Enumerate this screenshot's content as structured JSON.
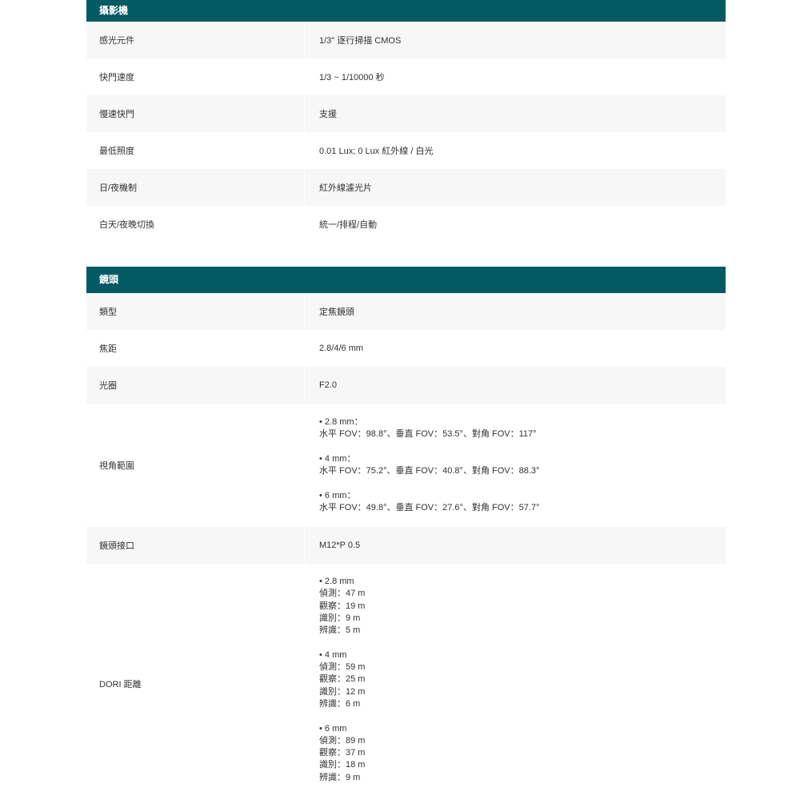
{
  "camera": {
    "header": "攝影機",
    "rows": [
      {
        "label": "感光元件",
        "value": "1/3\" 逐行掃描 CMOS"
      },
      {
        "label": "快門速度",
        "value": "1/3 ~ 1/10000 秒"
      },
      {
        "label": "慢速快門",
        "value": "支援"
      },
      {
        "label": "最低照度",
        "value": "0.01 Lux; 0 Lux 紅外線 / 白光"
      },
      {
        "label": "日/夜機制",
        "value": "紅外線濾光片"
      },
      {
        "label": "白天/夜晚切換",
        "value": "統一/排程/自動"
      }
    ]
  },
  "lens": {
    "header": "鏡頭",
    "rows": [
      {
        "label": "類型",
        "value": "定焦鏡頭"
      },
      {
        "label": "焦距",
        "value": "2.8/4/6 mm"
      },
      {
        "label": "光圈",
        "value": "F2.0"
      }
    ],
    "fov": {
      "label": "視角範圍",
      "lines": [
        "• 2.8 mm：",
        "水平 FOV：98.8°、垂直 FOV：53.5°、對角 FOV：117°",
        "",
        "• 4 mm：",
        "水平 FOV：75.2°、垂直 FOV：40.8°、對角 FOV：88.3°",
        "",
        "• 6 mm：",
        "水平 FOV：49.8°、垂直 FOV：27.6°、對角 FOV：57.7°"
      ]
    },
    "mount": {
      "label": "鏡頭接口",
      "value": "M12*P 0.5"
    },
    "dori": {
      "label": "DORI 距離",
      "lines": [
        "• 2.8 mm",
        "偵測：47 m",
        "觀察：19 m",
        "識別：9 m",
        "辨識：5 m",
        "",
        "• 4 mm",
        "偵測：59 m",
        "觀察：25 m",
        "識別：12 m",
        "辨識：6 m",
        "",
        "• 6 mm",
        "偵測：89 m",
        "觀察：37 m",
        "識別：18 m",
        "辨識：9 m"
      ]
    }
  }
}
